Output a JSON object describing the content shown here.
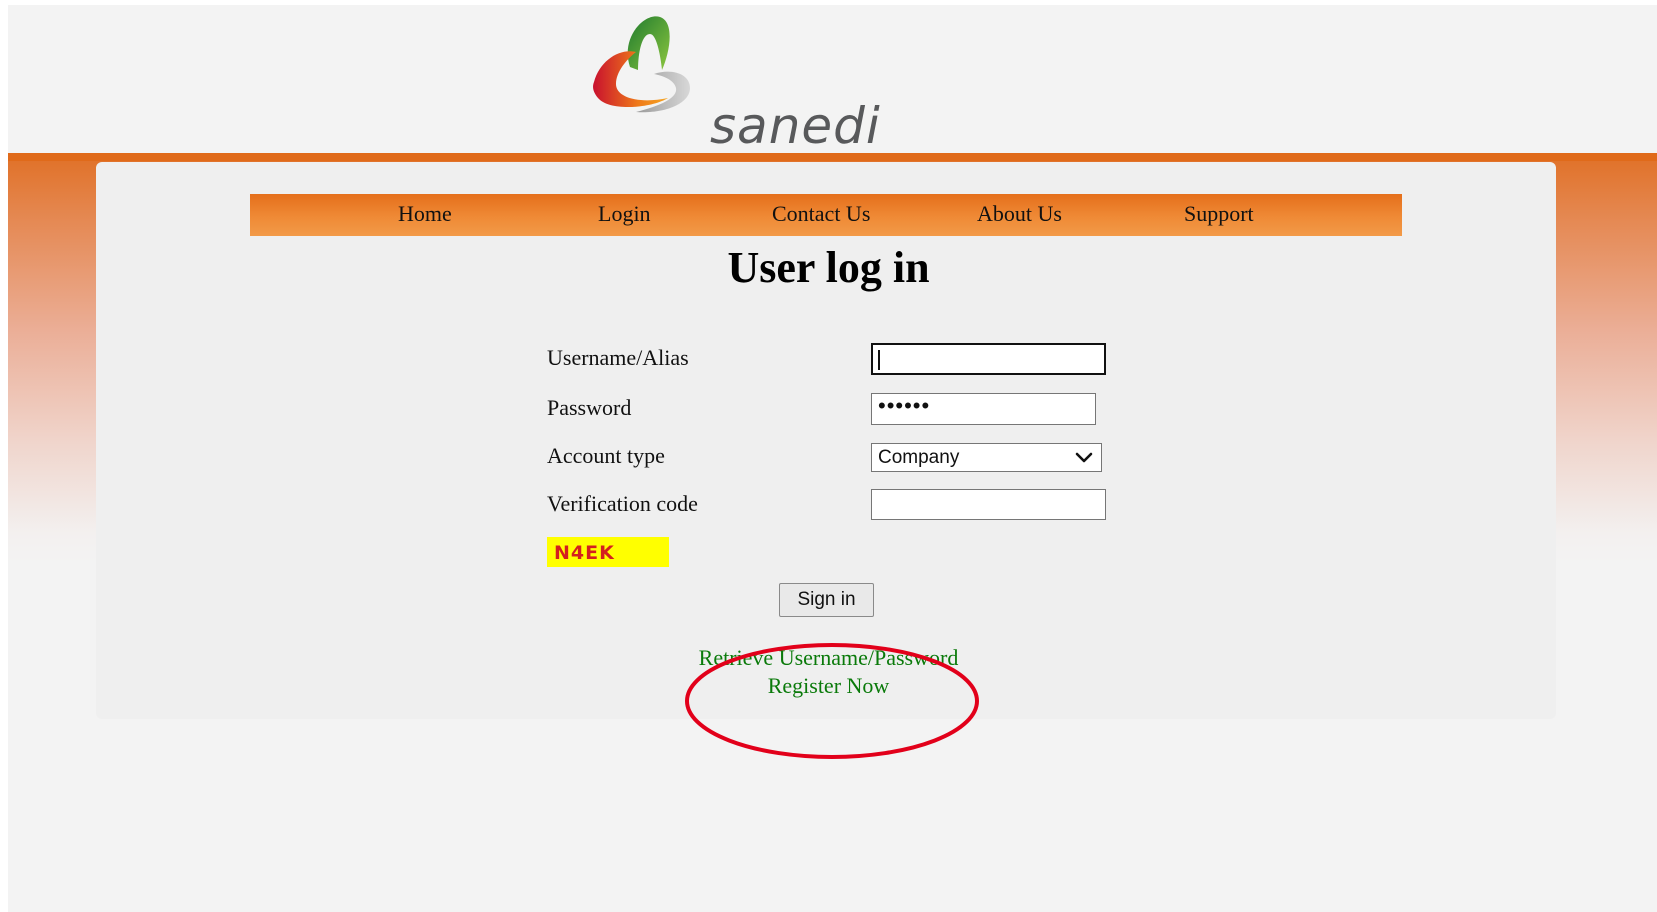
{
  "brand": {
    "name": "sanedi"
  },
  "nav": {
    "items": [
      {
        "label": "Home"
      },
      {
        "label": "Login"
      },
      {
        "label": "Contact Us"
      },
      {
        "label": "About Us"
      },
      {
        "label": "Support"
      }
    ]
  },
  "form": {
    "title": "User log in",
    "username_label": "Username/Alias",
    "username_value": "",
    "password_label": "Password",
    "password_mask": "••••••",
    "account_type_label": "Account type",
    "account_type_value": "Company",
    "verification_label": "Verification code",
    "verification_value": "",
    "captcha_code": "N4EK",
    "sign_in_label": "Sign in"
  },
  "links": {
    "retrieve": "Retrieve Username/Password",
    "register": "Register Now"
  },
  "colors": {
    "nav_orange": "#ef8a36",
    "link_green": "#0a7a0a",
    "captcha_bg": "#ffff00",
    "captcha_text": "#d41f1f",
    "annotation_red": "#e2001a"
  },
  "icons": {
    "logo": "sanedi-swirl-logo",
    "select_arrow": "chevron-down-icon"
  }
}
